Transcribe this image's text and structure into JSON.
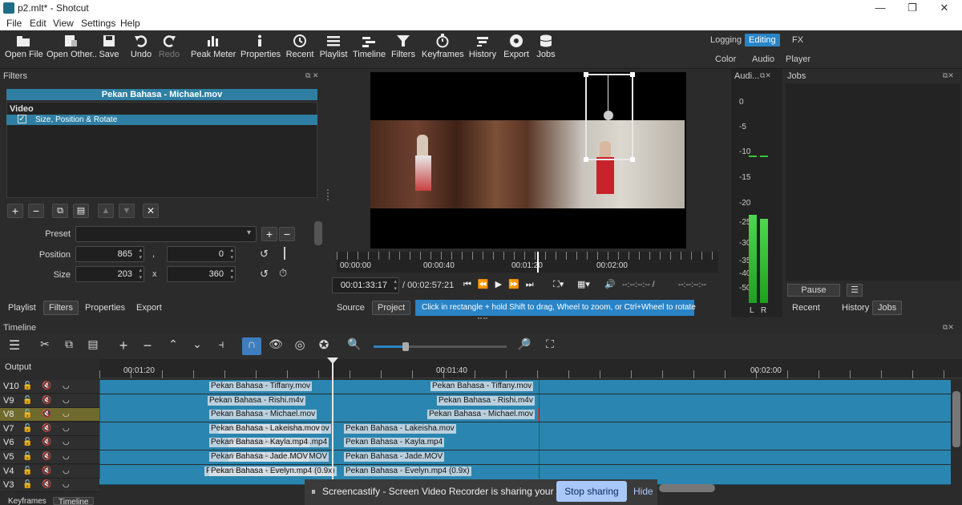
{
  "window": {
    "title": "p2.mlt* - Shotcut"
  },
  "menu": [
    "File",
    "Edit",
    "View",
    "Settings",
    "Help"
  ],
  "toolbar": [
    {
      "label": "Open File",
      "icon": "open-file-icon"
    },
    {
      "label": "Open Other..",
      "icon": "open-other-icon"
    },
    {
      "label": "Save",
      "icon": "save-icon"
    },
    {
      "label": "Undo",
      "icon": "undo-icon"
    },
    {
      "label": "Redo",
      "icon": "redo-icon"
    },
    {
      "label": "Peak Meter",
      "icon": "peak-meter-icon"
    },
    {
      "label": "Properties",
      "icon": "properties-icon"
    },
    {
      "label": "Recent",
      "icon": "recent-icon"
    },
    {
      "label": "Playlist",
      "icon": "playlist-icon"
    },
    {
      "label": "Timeline",
      "icon": "timeline-icon"
    },
    {
      "label": "Filters",
      "icon": "filters-icon"
    },
    {
      "label": "Keyframes",
      "icon": "keyframes-icon"
    },
    {
      "label": "History",
      "icon": "history-icon"
    },
    {
      "label": "Export",
      "icon": "export-icon"
    },
    {
      "label": "Jobs",
      "icon": "jobs-icon"
    }
  ],
  "layouts": {
    "row1": [
      "Logging",
      "Editing",
      "FX"
    ],
    "row2": [
      "Color",
      "Audio",
      "Player"
    ],
    "active": "Editing"
  },
  "filters": {
    "title": "Filters",
    "clip_name": "Pekan Bahasa - Michael.mov",
    "section": "Video",
    "items": [
      "Size, Position & Rotate"
    ],
    "preset_label": "Preset",
    "position_label": "Position",
    "position_x": "865",
    "position_sep": ",",
    "position_y": "0",
    "size_label": "Size",
    "size_w": "203",
    "size_sep": "x",
    "size_h": "360"
  },
  "left_tabs": [
    "Playlist",
    "Filters",
    "Properties",
    "Export"
  ],
  "left_active": "Filters",
  "player": {
    "ruler": [
      "00:00:00",
      "00:00:40",
      "00:01:20",
      "00:02:00"
    ],
    "current_time": "00:01:33:17",
    "total_time": "/ 00:02:57:21",
    "in_point": "--:--:--:--  /",
    "out_point": "--:--:--:--",
    "tabs": [
      "Source",
      "Project"
    ],
    "hint": "Click in rectangle + hold Shift to drag, Wheel to zoom, or Ctrl+Wheel to rotate"
  },
  "audio": {
    "title": "Audi...",
    "scale": [
      "0",
      "-5",
      "-10",
      "-15",
      "-20",
      "-25",
      "-30",
      "-35",
      "-40",
      "-50"
    ],
    "channels": [
      "L",
      "R"
    ],
    "level_left": 0.58,
    "level_right": 0.55
  },
  "jobs": {
    "title": "Jobs",
    "pause_label": "Pause",
    "tabs": [
      "Recent",
      "History",
      "Jobs"
    ],
    "active_tab": "Jobs"
  },
  "timeline": {
    "title": "Timeline",
    "output_label": "Output",
    "ruler": [
      "00:01:20",
      "00:01:40",
      "00:02:00"
    ],
    "tracks": [
      {
        "name": "V10",
        "clips": [
          {
            "label": "Pekan Bahasa - Tiffany.mov"
          },
          {
            "label": "Pekan Bahasa - Tiffany.mov"
          }
        ]
      },
      {
        "name": "V9",
        "clips": [
          {
            "label": "Pekan Bahasa - Rishi.m4v"
          },
          {
            "label": "Pekan Bahasa - Rishi.m4v"
          }
        ]
      },
      {
        "name": "V8",
        "selected": true,
        "clips": [
          {
            "label": "Pekan Bahasa - Michael.mov"
          },
          {
            "label": "Pekan Bahasa - Michael.mov"
          }
        ]
      },
      {
        "name": "V7",
        "clips": [
          {
            "label": "Pekan Bahasa - Lakeisha.mov"
          },
          {
            "label": "Pekan Bahasa - Lakeisha.mov"
          },
          {
            "label": "Pekan Bahasa - Lakeisha.mov"
          }
        ]
      },
      {
        "name": "V6",
        "clips": [
          {
            "label": "Pekan Bahasa - Kayla.mp4"
          },
          {
            "label": "Pekan Bahasa - Kayla.mp4"
          },
          {
            "label": "Pekan Bahasa - Kayla.mp4"
          }
        ]
      },
      {
        "name": "V5",
        "clips": [
          {
            "label": "Pekan Bahasa - Jade.MOV"
          },
          {
            "label": "Pekan Bahasa - Jade.MOV"
          },
          {
            "label": "Pekan Bahasa - Jade.MOV"
          }
        ]
      },
      {
        "name": "V4",
        "clips": [
          {
            "label": "Pekan Bahasa - Evelyn.mp4 (0.9x)"
          },
          {
            "label": "Pekan Bahasa - Evelyn.mp4 (0.9x)"
          },
          {
            "label": "Pekan Bahasa - Evelyn.mp4 (0.9x)"
          }
        ]
      },
      {
        "name": "V3",
        "clips": []
      }
    ]
  },
  "bottom_tabs": [
    "Keyframes",
    "Timeline"
  ],
  "share_banner": {
    "text": "Screencastify - Screen Video Recorder is sharing your screen.",
    "stop_label": "Stop sharing",
    "hide_label": "Hide"
  },
  "colors": {
    "accent": "#2a84c6",
    "clip": "#2a86b0",
    "selected_track": "#6f6a2d"
  }
}
